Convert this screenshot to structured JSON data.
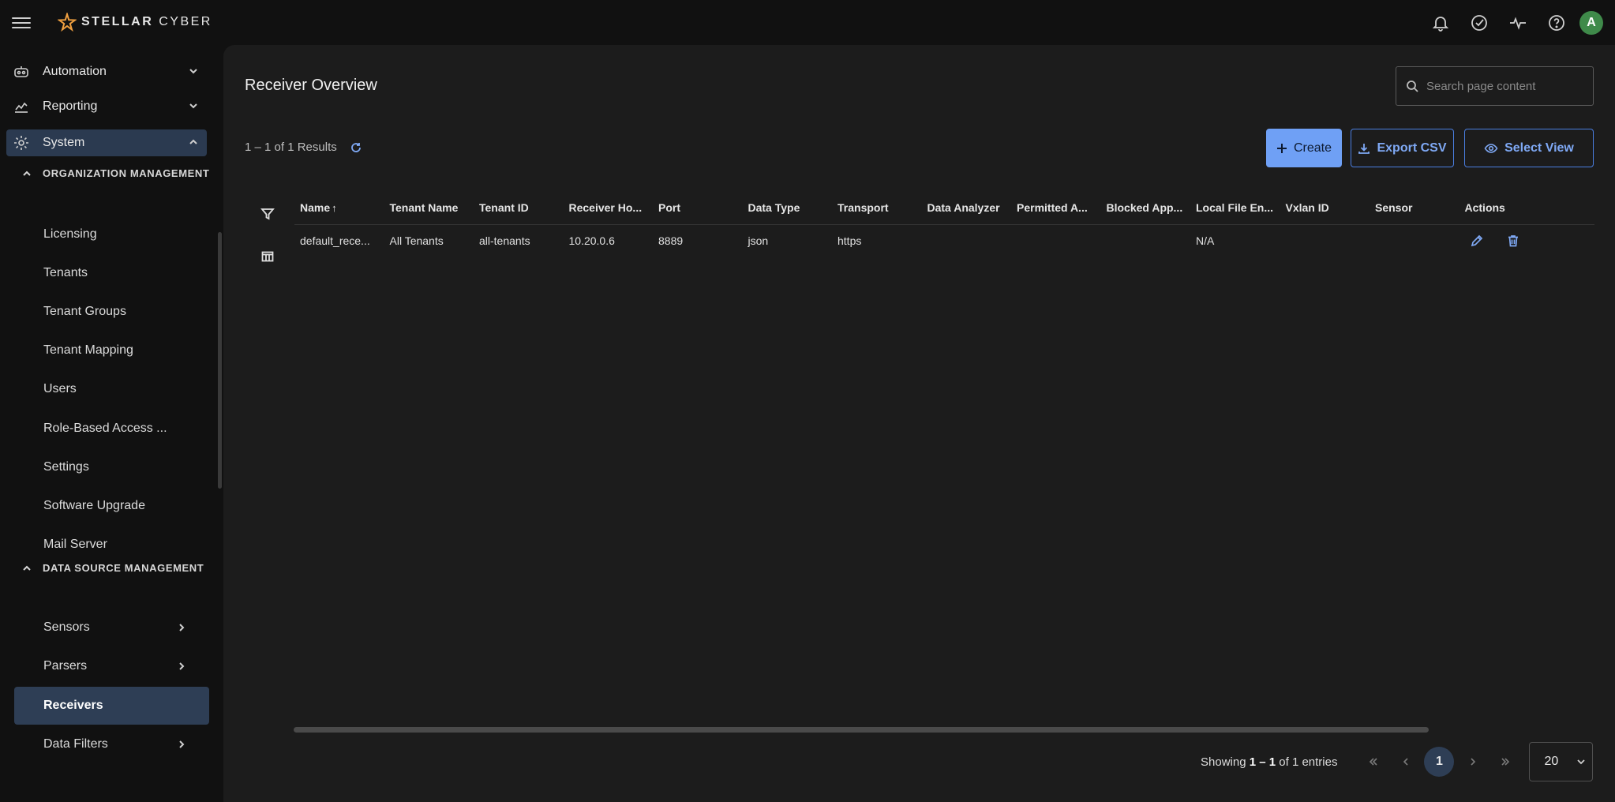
{
  "app": {
    "brand": "STELLAR CYBER",
    "brand_bold": "STELLAR",
    "brand_thin": "CYBER"
  },
  "header": {
    "icons": [
      "bell-icon",
      "check-circle-icon",
      "pulse-icon",
      "help-icon"
    ],
    "avatar_initial": "A",
    "avatar_color": "#3f8a4a"
  },
  "sidebar": {
    "top_items": [
      {
        "label": "Automation",
        "icon": "robot-icon"
      },
      {
        "label": "Reporting",
        "icon": "chart-line-icon"
      },
      {
        "label": "System",
        "icon": "gear-icon"
      }
    ],
    "sections": [
      {
        "label": "ORGANIZATION MANAGEMENT"
      },
      {
        "label": "DATA SOURCE MANAGEMENT"
      }
    ],
    "org_items": [
      {
        "label": "Licensing"
      },
      {
        "label": "Tenants"
      },
      {
        "label": "Tenant Groups"
      },
      {
        "label": "Tenant Mapping"
      },
      {
        "label": "Users"
      },
      {
        "label": "Role-Based Access ..."
      },
      {
        "label": "Settings"
      },
      {
        "label": "Software Upgrade"
      },
      {
        "label": "Mail Server"
      }
    ],
    "ds_items": [
      {
        "label": "Sensors"
      },
      {
        "label": "Parsers"
      },
      {
        "label": "Receivers"
      },
      {
        "label": "Data Filters"
      }
    ]
  },
  "main": {
    "title": "Receiver Overview",
    "search_placeholder": "Search page content",
    "results_text": "1 – 1 of 1 Results",
    "buttons": {
      "create": "Create",
      "export": "Export CSV",
      "select_view": "Select View"
    },
    "accent_color": "#6fa0f5"
  },
  "table": {
    "columns": [
      "Name",
      "Tenant Name",
      "Tenant ID",
      "Receiver Ho...",
      "Port",
      "Data Type",
      "Transport",
      "Data Analyzer",
      "Permitted A...",
      "Blocked App...",
      "Local File En...",
      "Vxlan ID",
      "Sensor",
      "Actions"
    ],
    "sort_indicator": "↑",
    "rows": [
      [
        "default_rece...",
        "All Tenants",
        "all-tenants",
        "10.20.0.6",
        "8889",
        "json",
        "https",
        "",
        "",
        "",
        "N/A",
        "",
        ""
      ]
    ]
  },
  "pagination": {
    "showing_prefix": "Showing ",
    "showing_range": "1 – 1",
    "showing_suffix": " of 1 entries",
    "current_page": "1",
    "page_size": "20"
  }
}
